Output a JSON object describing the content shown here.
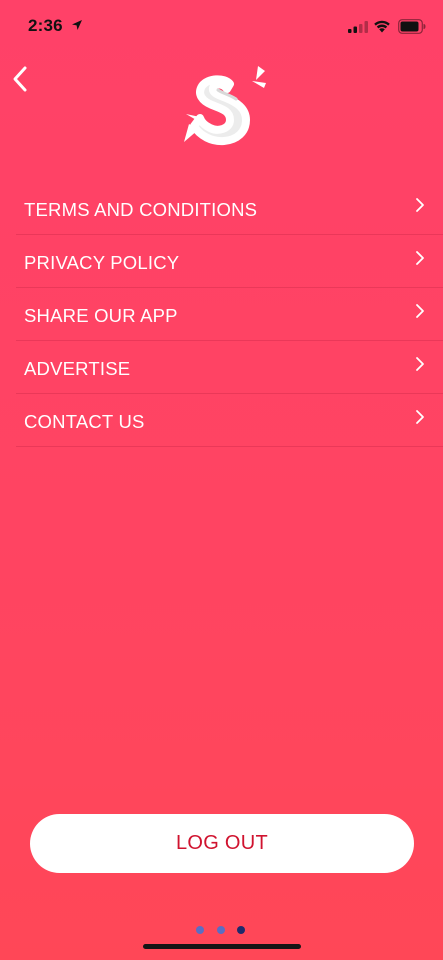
{
  "status_bar": {
    "time": "2:36"
  },
  "menu": {
    "items": [
      {
        "label": "TERMS AND CONDITIONS"
      },
      {
        "label": "PRIVACY POLICY"
      },
      {
        "label": "SHARE OUR APP"
      },
      {
        "label": "ADVERTISE"
      },
      {
        "label": "CONTACT US"
      }
    ]
  },
  "logout": {
    "label": "LOG OUT"
  },
  "pagination": {
    "total": 3,
    "active_index": 2
  },
  "colors": {
    "background": "#ff4465",
    "logout_text": "#d0132f",
    "dot_inactive": "#5a6ec4",
    "dot_active": "#1f2a6b"
  },
  "icons": {
    "back": "chevron-left-icon",
    "logo": "app-logo",
    "menu_chevron": "chevron-right-icon",
    "location": "location-arrow-icon",
    "signal": "cellular-signal-icon",
    "wifi": "wifi-icon",
    "battery": "battery-icon"
  }
}
